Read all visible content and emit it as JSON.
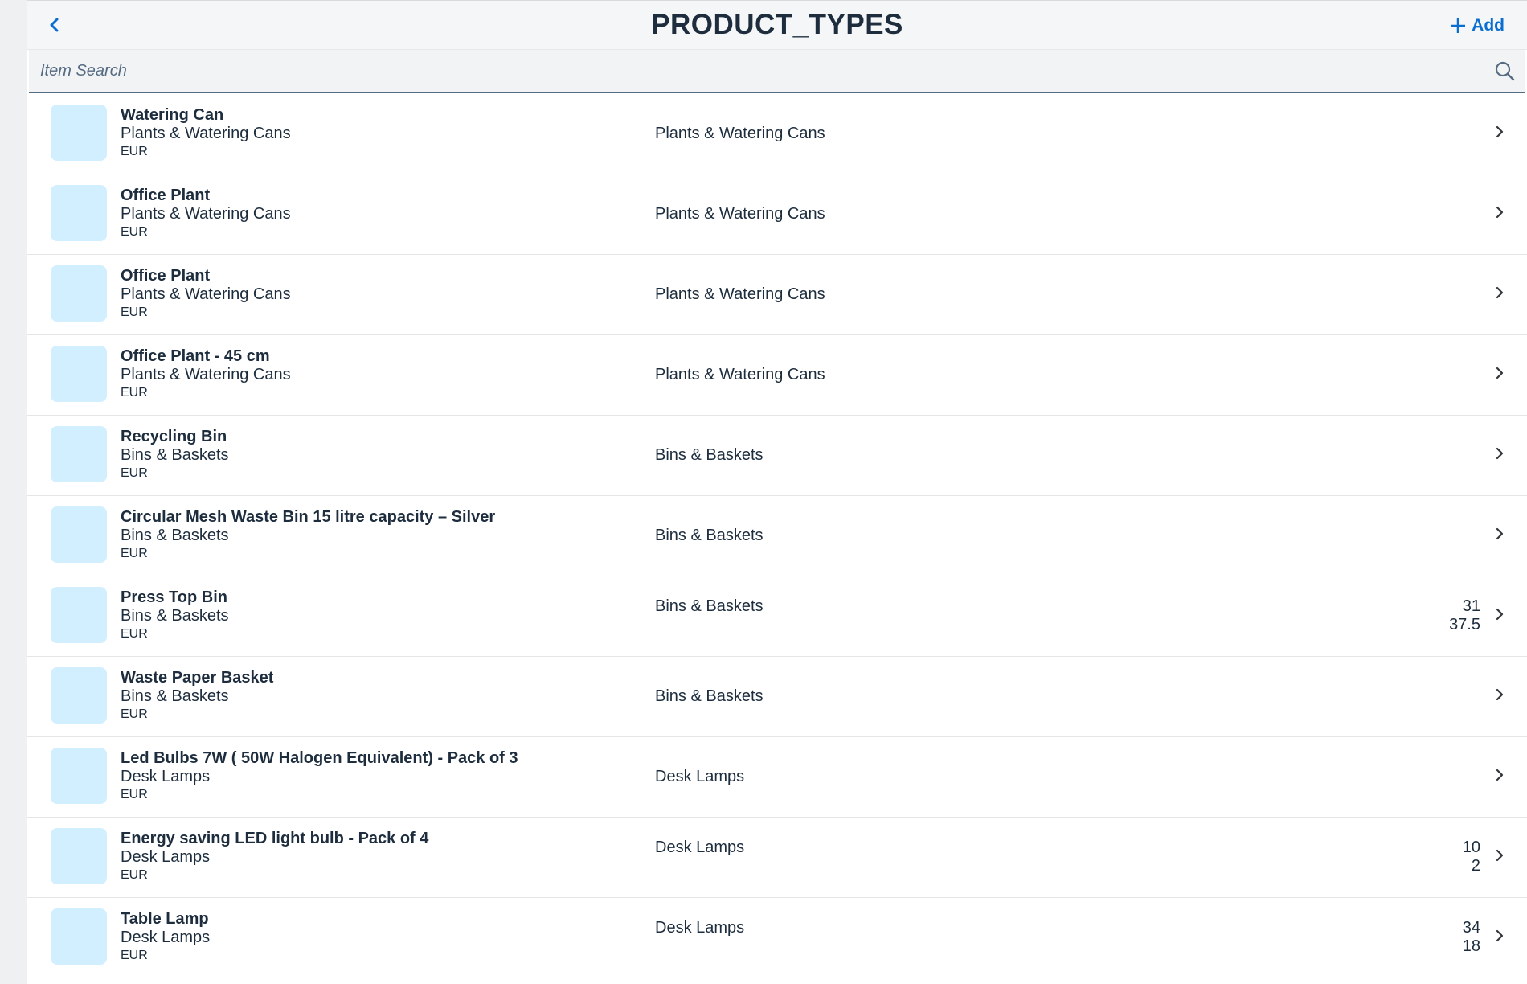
{
  "header": {
    "title": "PRODUCT_TYPES",
    "add_label": "Add"
  },
  "search": {
    "placeholder": "Item Search",
    "value": ""
  },
  "colors": {
    "accent": "#0a6ed1",
    "thumbnail": "#d1efff",
    "text": "#1d2d3e"
  },
  "icons": {
    "back": "chevron-left-icon",
    "add": "plus-icon",
    "search": "search-icon",
    "row_nav": "chevron-right-icon"
  },
  "items": [
    {
      "title": "Watering Can",
      "subtitle": "Plants & Watering Cans",
      "currency": "EUR",
      "category": "Plants & Watering Cans",
      "num1": "",
      "num2": ""
    },
    {
      "title": "Office Plant",
      "subtitle": "Plants & Watering Cans",
      "currency": "EUR",
      "category": "Plants & Watering Cans",
      "num1": "",
      "num2": ""
    },
    {
      "title": "Office Plant",
      "subtitle": "Plants & Watering Cans",
      "currency": "EUR",
      "category": "Plants & Watering Cans",
      "num1": "",
      "num2": ""
    },
    {
      "title": "Office Plant - 45 cm",
      "subtitle": "Plants & Watering Cans",
      "currency": "EUR",
      "category": "Plants & Watering Cans",
      "num1": "",
      "num2": ""
    },
    {
      "title": "Recycling Bin",
      "subtitle": "Bins & Baskets",
      "currency": "EUR",
      "category": "Bins & Baskets",
      "num1": "",
      "num2": ""
    },
    {
      "title": "Circular Mesh Waste Bin 15 litre capacity – Silver",
      "subtitle": "Bins & Baskets",
      "currency": "EUR",
      "category": "Bins & Baskets",
      "num1": "",
      "num2": ""
    },
    {
      "title": "Press Top Bin",
      "subtitle": "Bins & Baskets",
      "currency": "EUR",
      "category": "Bins & Baskets",
      "num1": "31",
      "num2": "37.5"
    },
    {
      "title": "Waste Paper Basket",
      "subtitle": "Bins & Baskets",
      "currency": "EUR",
      "category": "Bins & Baskets",
      "num1": "",
      "num2": ""
    },
    {
      "title": "Led Bulbs 7W ( 50W Halogen Equivalent) - Pack of 3",
      "subtitle": "Desk Lamps",
      "currency": "EUR",
      "category": "Desk Lamps",
      "num1": "",
      "num2": ""
    },
    {
      "title": "Energy saving LED light bulb - Pack of 4",
      "subtitle": "Desk Lamps",
      "currency": "EUR",
      "category": "Desk Lamps",
      "num1": "10",
      "num2": "2"
    },
    {
      "title": "Table Lamp",
      "subtitle": "Desk Lamps",
      "currency": "EUR",
      "category": "Desk Lamps",
      "num1": "34",
      "num2": "18"
    }
  ]
}
